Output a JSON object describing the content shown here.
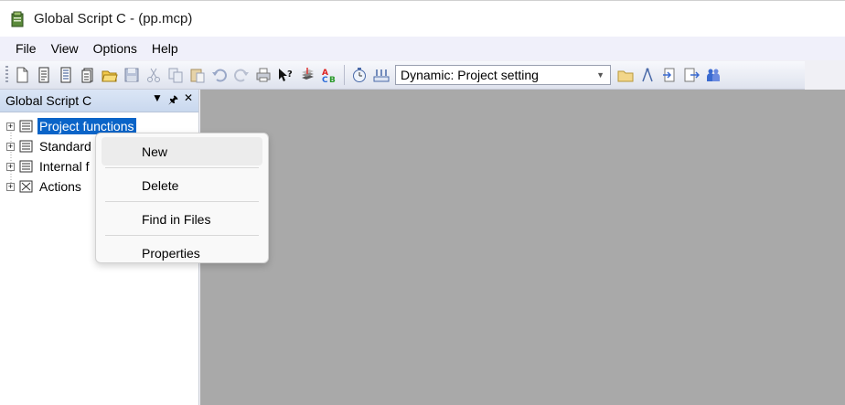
{
  "window": {
    "title": "Global Script C - (pp.mcp)",
    "icon": "gscript-app-icon"
  },
  "menubar": {
    "items": [
      "File",
      "View",
      "Options",
      "Help"
    ]
  },
  "toolbar": {
    "dynamic_select": {
      "value": "Dynamic: Project setting"
    }
  },
  "panel": {
    "title": "Global Script C",
    "tree": [
      {
        "label": "Project functions",
        "selected": true
      },
      {
        "label": "Standard"
      },
      {
        "label": "Internal f"
      },
      {
        "label": "Actions"
      }
    ]
  },
  "context_menu": {
    "items": [
      {
        "label": "New"
      },
      {
        "label": "Delete"
      },
      {
        "label": "Find in Files"
      },
      {
        "label": "Properties"
      }
    ]
  }
}
